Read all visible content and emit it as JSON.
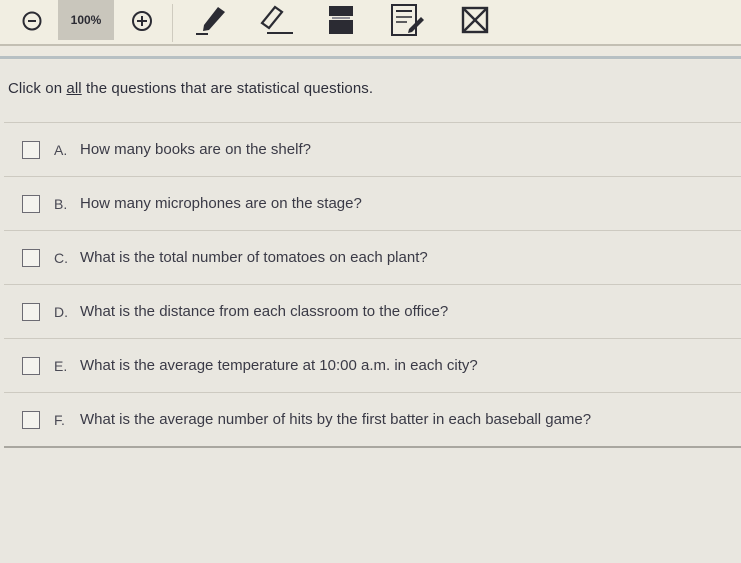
{
  "toolbar": {
    "zoom_out_icon": "zoom-out-icon",
    "zoom_level": "100%",
    "zoom_in_icon": "zoom-in-icon",
    "tools": [
      {
        "name": "pencil-icon"
      },
      {
        "name": "eraser-icon"
      },
      {
        "name": "highlighter-icon"
      },
      {
        "name": "notepad-icon"
      },
      {
        "name": "strikethrough-icon"
      }
    ]
  },
  "question": {
    "prompt_before": "Click on ",
    "prompt_emphasis": "all",
    "prompt_after": " the questions that are statistical questions.",
    "options": [
      {
        "letter": "A.",
        "text": "How many books are on the shelf?"
      },
      {
        "letter": "B.",
        "text": "How many microphones are on the stage?"
      },
      {
        "letter": "C.",
        "text": "What is the total number of tomatoes on each plant?"
      },
      {
        "letter": "D.",
        "text": "What is the distance from each classroom to the office?"
      },
      {
        "letter": "E.",
        "text": "What is the average temperature at 10:00 a.m. in each city?"
      },
      {
        "letter": "F.",
        "text": "What is the average number of hits by the first batter in each baseball game?"
      }
    ]
  },
  "colors": {
    "toolbar_bg": "#f1eee2",
    "content_bg": "#e9e7e0",
    "text": "#3a3a46",
    "accent_dark": "#2b2b33"
  }
}
